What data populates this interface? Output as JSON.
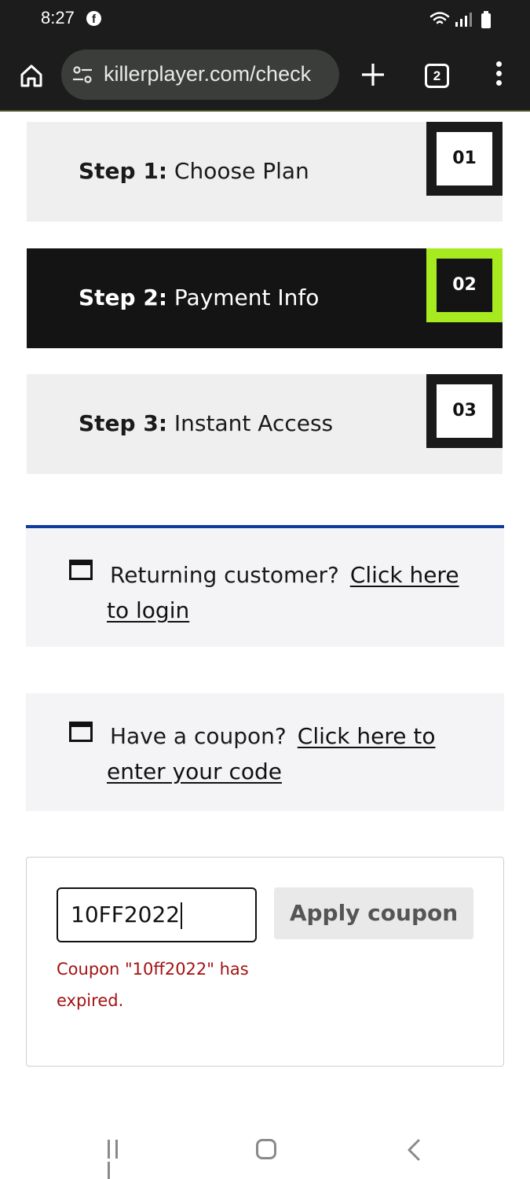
{
  "status_bar": {
    "time": "8:27",
    "app_icon": "facebook-icon"
  },
  "browser": {
    "url": "killerplayer.com/check",
    "tab_count": "2"
  },
  "steps": [
    {
      "number": "01",
      "title": "Step 1:",
      "label": "Choose Plan",
      "active": false
    },
    {
      "number": "02",
      "title": "Step 2:",
      "label": "Payment Info",
      "active": true
    },
    {
      "number": "03",
      "title": "Step 3:",
      "label": "Instant Access",
      "active": false
    }
  ],
  "returning": {
    "text": "Returning customer?",
    "link": "Click here to login"
  },
  "coupon_notice": {
    "text": "Have a coupon?",
    "link": "Click here to enter your code"
  },
  "coupon_form": {
    "value": "10FF2022",
    "button": "Apply coupon",
    "error": "Coupon \"10ff2022\" has expired."
  },
  "colors": {
    "accent": "#a6ea1f",
    "notice_border": "#113c9e",
    "error": "#a31212"
  }
}
